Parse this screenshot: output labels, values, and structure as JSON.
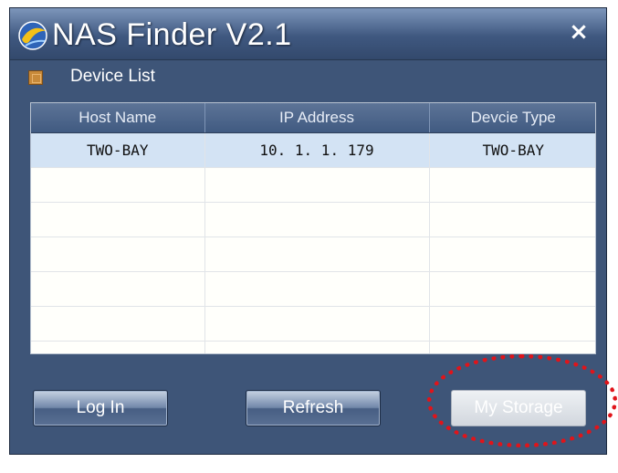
{
  "window": {
    "title": "NAS Finder V2.1",
    "app_icon": "globe-icon",
    "close_icon": "close-icon",
    "close_glyph": "×"
  },
  "device_list": {
    "label": "Device List",
    "icon": "device-list-icon",
    "columns": [
      "Host Name",
      "IP Address",
      "Devcie Type"
    ],
    "rows": [
      [
        "TWO-BAY",
        "10. 1. 1. 179",
        "TWO-BAY"
      ],
      [
        "",
        "",
        ""
      ],
      [
        "",
        "",
        ""
      ],
      [
        "",
        "",
        ""
      ],
      [
        "",
        "",
        ""
      ],
      [
        "",
        "",
        ""
      ],
      [
        "",
        "",
        ""
      ]
    ],
    "selected_row_index": 0
  },
  "buttons": {
    "login_label": "Log In",
    "refresh_label": "Refresh",
    "my_storage_label": "My Storage",
    "my_storage_enabled": false
  },
  "annotation": {
    "highlight_color": "#e0141a",
    "highlight_target": "my-storage-button"
  },
  "colors": {
    "window_bg": "#3e5578",
    "header_bg": "#405a81",
    "selected_row_bg": "#d3e3f4"
  }
}
